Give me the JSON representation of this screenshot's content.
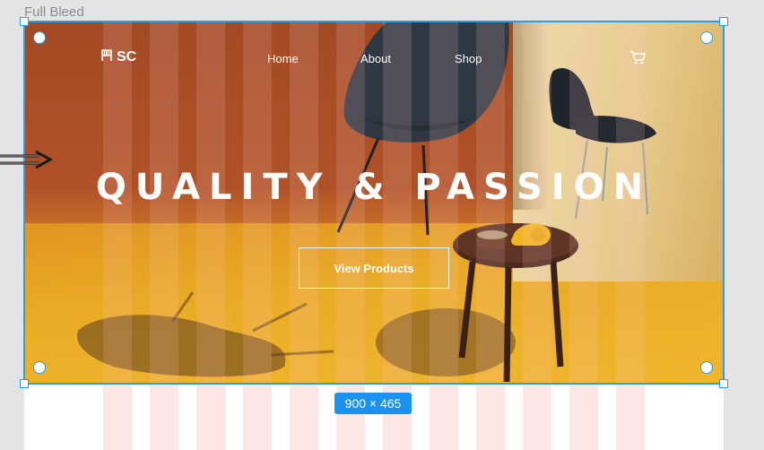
{
  "frame": {
    "label": "Full Bleed",
    "size_badge": "900 × 465"
  },
  "nav": {
    "logo_text": "SC",
    "logo_icon": "chair-icon",
    "links": [
      "Home",
      "About",
      "Shop"
    ],
    "cart_icon": "cart-icon"
  },
  "hero": {
    "title": "QUALITY & PASSION",
    "cta_label": "View Products"
  },
  "colors": {
    "selection": "#2b9fe6",
    "badge": "#1a93f0",
    "backdrop": "#a24a24",
    "floor": "#e9ad2d"
  }
}
